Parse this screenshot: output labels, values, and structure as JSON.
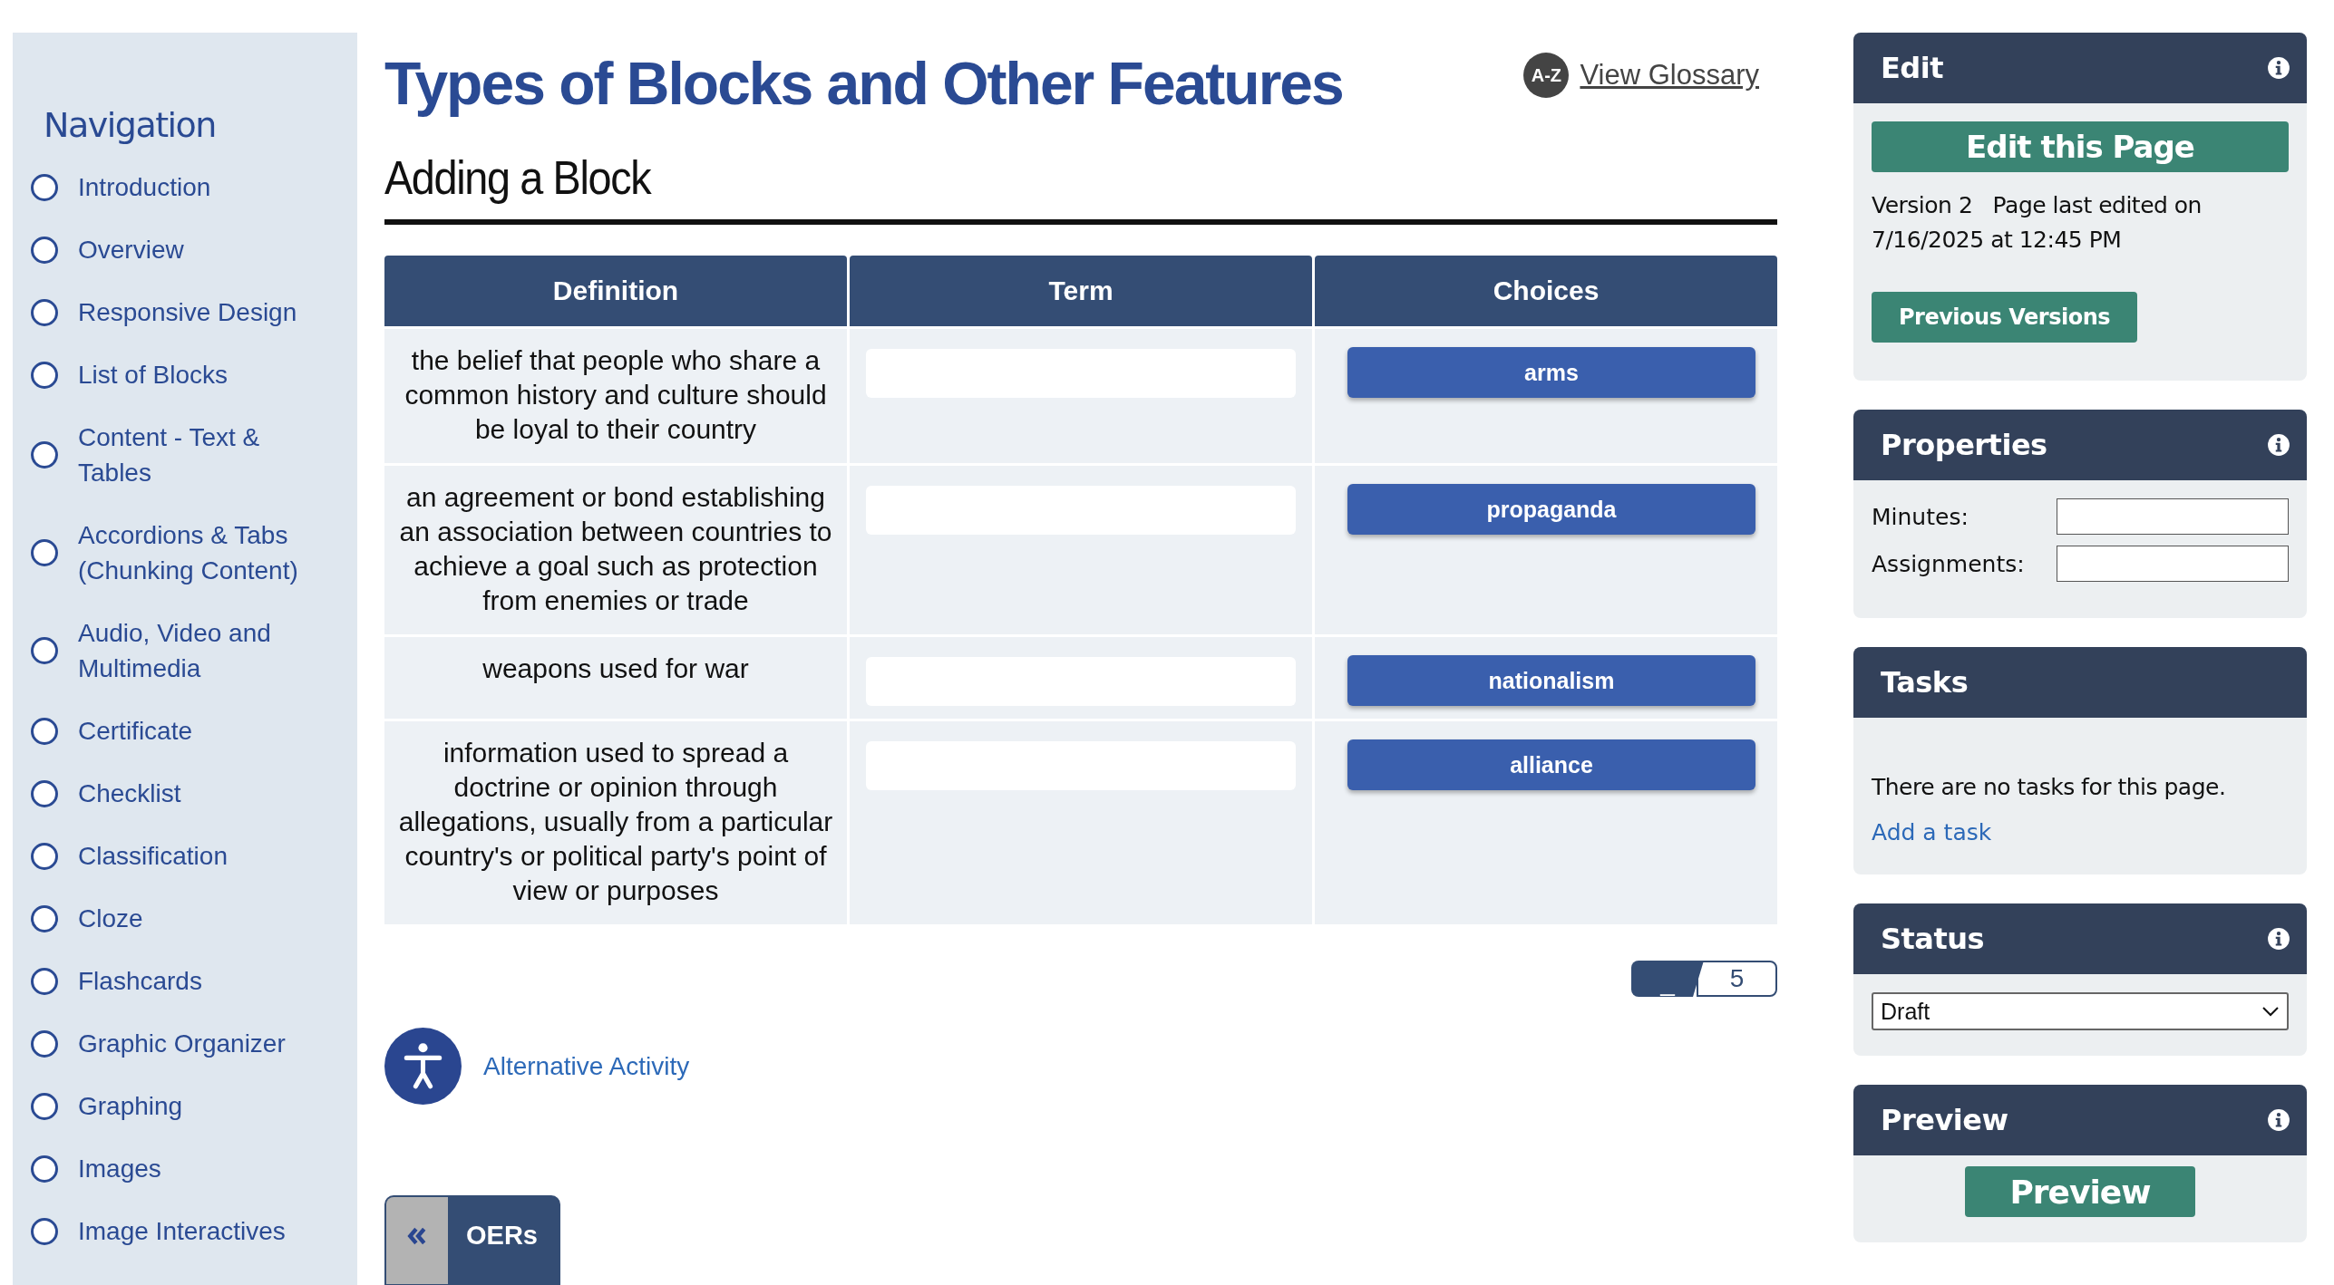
{
  "sidebar": {
    "heading": "Navigation",
    "items": [
      {
        "label": "Introduction",
        "selected": false
      },
      {
        "label": "Overview",
        "selected": false
      },
      {
        "label": "Responsive Design",
        "selected": false
      },
      {
        "label": "List of Blocks",
        "selected": false
      },
      {
        "label": "Content - Text & Tables",
        "selected": false
      },
      {
        "label": "Accordions & Tabs (Chunking Content)",
        "selected": false
      },
      {
        "label": "Audio, Video and Multimedia",
        "selected": false
      },
      {
        "label": "Certificate",
        "selected": false
      },
      {
        "label": "Checklist",
        "selected": false
      },
      {
        "label": "Classification",
        "selected": false
      },
      {
        "label": "Cloze",
        "selected": false
      },
      {
        "label": "Flashcards",
        "selected": false
      },
      {
        "label": "Graphic Organizer",
        "selected": false
      },
      {
        "label": "Graphing",
        "selected": false
      },
      {
        "label": "Images",
        "selected": false
      },
      {
        "label": "Image Interactives",
        "selected": false
      }
    ]
  },
  "glossary": {
    "badge": "A-Z",
    "link": "View Glossary"
  },
  "title": "Types of Blocks and Other Features",
  "subtitle": "Adding a Block",
  "table": {
    "columns": [
      "Definition",
      "Term",
      "Choices"
    ],
    "rows": [
      {
        "definition": "the belief that people who share a common history and culture should be loyal to their country",
        "choice": "arms"
      },
      {
        "definition": "an agreement or bond establishing an association between countries to achieve a goal such as protection from enemies or trade",
        "choice": "propaganda"
      },
      {
        "definition": "weapons used for war",
        "choice": "nationalism"
      },
      {
        "definition": "information used to spread a doctrine or opinion through allegations, usually from a particular country's or political party's point of view or purposes",
        "choice": "alliance"
      }
    ]
  },
  "pagination": {
    "current": "_",
    "total": "5"
  },
  "alternative_activity": "Alternative Activity",
  "oers_button": "OERs",
  "panels": [
    {
      "kind": "edit",
      "title": "Edit",
      "info_icon": true,
      "button": "Edit this Page",
      "version": "Version 2",
      "edited": "Page last edited on 7/16/2025 at 12:45 PM",
      "secondary_button": "Previous Versions"
    },
    {
      "kind": "properties",
      "title": "Properties",
      "info_icon": true,
      "fields": [
        {
          "label": "Minutes:"
        },
        {
          "label": "Assignments:"
        }
      ]
    },
    {
      "kind": "tasks",
      "title": "Tasks",
      "info_icon": false,
      "message": "There are no tasks for this page.",
      "link": "Add a task"
    },
    {
      "kind": "status",
      "title": "Status",
      "info_icon": true,
      "value": "Draft"
    },
    {
      "kind": "preview",
      "title": "Preview",
      "info_icon": true,
      "button": "Preview"
    }
  ]
}
